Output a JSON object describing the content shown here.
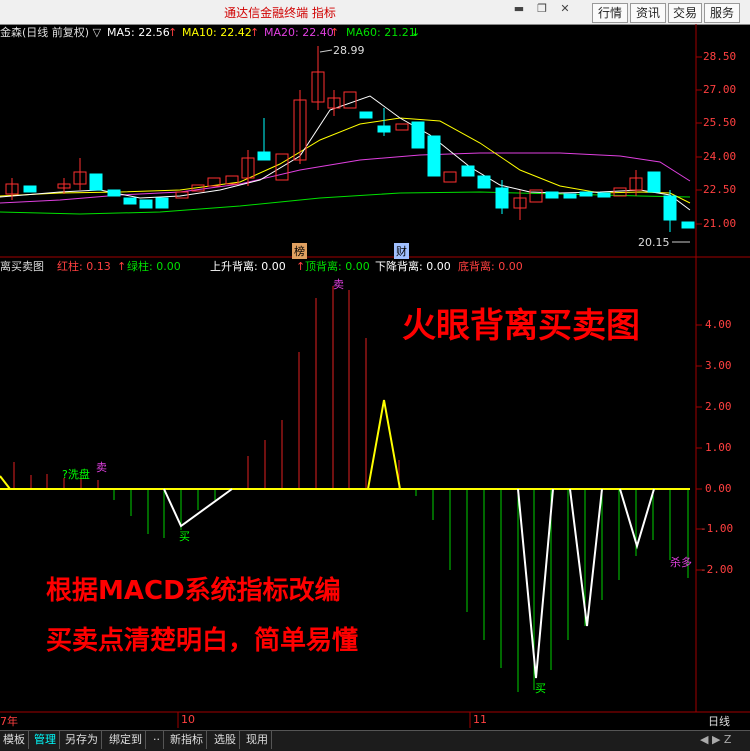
{
  "titlebar": {
    "app_title": "通达信金融终端  指标",
    "buttons": [
      "行情",
      "资讯",
      "交易",
      "服务"
    ]
  },
  "main_chart": {
    "stock_label": "金森(日线 前复权) ▽",
    "ma5": "MA5: 22.56",
    "ma10": "MA10: 22.42",
    "ma20": "MA20: 22.40",
    "ma60": "MA60: 21.21",
    "arrow_up": "↑",
    "arrow_down": "↓",
    "high_label": "28.99",
    "low_label": "20.15",
    "y_ticks": [
      "28.50",
      "27.00",
      "25.50",
      "24.00",
      "22.50",
      "21.00"
    ],
    "event_tags": [
      "榜",
      "财"
    ],
    "colors": {
      "ma5": "#ffffff",
      "ma10": "#ffff00",
      "ma20": "#e040e0",
      "ma60": "#00e000",
      "up": "#ff3030",
      "down": "#00ffff"
    }
  },
  "indicator": {
    "name": "离买卖图",
    "red_bar": "红柱: 0.13",
    "green_bar": "绿柱: 0.00",
    "up_div": "上升背离: 0.00",
    "top_div": "顶背离: 0.00",
    "down_div": "下降背离: 0.00",
    "bottom_div": "底背离: 0.00",
    "y_ticks": [
      "4.00",
      "3.00",
      "2.00",
      "1.00",
      "0.00",
      "-1.00",
      "-2.00"
    ],
    "signals": {
      "sell_top": "卖",
      "sell_left": "卖",
      "wash": "?洗盘",
      "buy_left": "买",
      "buy_bottom": "买",
      "kill": "杀多"
    },
    "title_overlay": "火眼背离买卖图",
    "caption_line1": "根据MACD系统指标改编",
    "caption_line2": "买卖点清楚明白，简单易懂"
  },
  "time_axis": {
    "labels": [
      "7年",
      "10",
      "11"
    ],
    "period": "日线"
  },
  "bottom_tabs": [
    "模板",
    "管理",
    "另存为",
    "绑定到",
    "··",
    "新指标",
    "选股",
    "现用"
  ]
}
